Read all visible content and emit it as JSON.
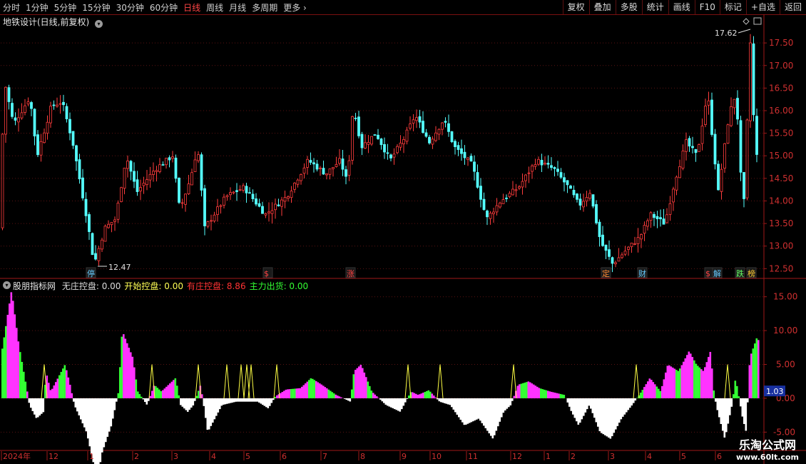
{
  "toolbar": {
    "periods": [
      "分时",
      "1分钟",
      "5分钟",
      "15分钟",
      "30分钟",
      "60分钟",
      "日线",
      "周线",
      "月线",
      "多周期",
      "更多"
    ],
    "active_period": "日线",
    "tools": [
      "复权",
      "叠加",
      "多股",
      "统计",
      "画线",
      "F10",
      "标记",
      "+自选",
      "返回"
    ]
  },
  "chart_title": "地铁设计(日线,前复权)",
  "indicator": {
    "name": "股朋指标网",
    "items": [
      {
        "label": "无庄控盘:",
        "value": "0.00",
        "color": "#dcdcdc"
      },
      {
        "label": "开始控盘:",
        "value": "0.00",
        "color": "#ffff55"
      },
      {
        "label": "有庄控盘:",
        "value": "8.86",
        "color": "#ff3333"
      },
      {
        "label": "主力出货:",
        "value": "0.00",
        "color": "#33ff33"
      }
    ]
  },
  "chart_data": [
    {
      "type": "candlestick",
      "ylim": [
        12.3,
        17.85
      ],
      "price_ticks": [
        "17.50",
        "17.00",
        "16.50",
        "16.00",
        "15.50",
        "15.00",
        "14.50",
        "14.00",
        "13.50",
        "13.00",
        "12.50"
      ],
      "high_label": "17.62",
      "low_label": "12.47",
      "event_markers": [
        {
          "text": "停",
          "color": "#66ccff"
        },
        {
          "text": "$",
          "color": "#ff4444"
        },
        {
          "text": "涨",
          "color": "#ff4444"
        },
        {
          "text": "定",
          "color": "#ff8833"
        },
        {
          "text": "财",
          "color": "#66ccff"
        },
        {
          "text": "$",
          "color": "#ff4444"
        },
        {
          "text": "解",
          "color": "#66ccff"
        },
        {
          "text": "跌",
          "color": "#66ff66"
        },
        {
          "text": "榜",
          "color": "#ffcc33"
        }
      ]
    },
    {
      "type": "bar",
      "ylim": [
        -7.6,
        17.5
      ],
      "value_ticks": [
        "15.00",
        "10.00",
        "5.00",
        "0.00",
        "-5.00"
      ],
      "current_value": "1.03"
    }
  ],
  "date_axis": [
    "2024年",
    "12",
    "1",
    "2",
    "3",
    "4",
    "5",
    "6",
    "7",
    "8",
    "9",
    "10",
    "11",
    "12",
    "1",
    "2",
    "3",
    "4",
    "5",
    "6"
  ],
  "watermark": {
    "line1": "乐淘公式网",
    "line2": "www.60lt.com"
  }
}
